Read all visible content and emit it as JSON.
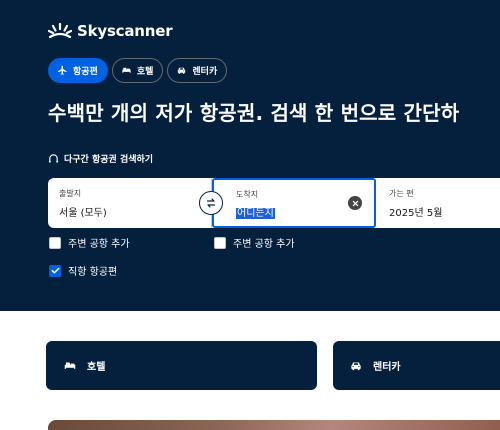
{
  "brand": {
    "name": "Skyscanner"
  },
  "tabs": [
    {
      "label": "항공편",
      "icon": "plane-icon",
      "active": true
    },
    {
      "label": "호텔",
      "icon": "bed-icon",
      "active": false
    },
    {
      "label": "렌터카",
      "icon": "car-icon",
      "active": false
    }
  ],
  "headline": "수백만 개의 저가 항공권. 검색 한 번으로 간단하",
  "multicity_label": "다구간 항공권 검색하기",
  "search": {
    "from": {
      "label": "출발지",
      "value": "서울 (모두)"
    },
    "to": {
      "label": "도착지",
      "value": "어디든지"
    },
    "depart": {
      "label": "가는 편",
      "value": "2025년 5월"
    }
  },
  "options": {
    "nearby_from": {
      "label": "주변 공항 추가",
      "checked": false
    },
    "nearby_to": {
      "label": "주변 공항 추가",
      "checked": false
    },
    "direct": {
      "label": "직항 항공편",
      "checked": true
    }
  },
  "cards": [
    {
      "label": "호텔",
      "icon": "bed-icon"
    },
    {
      "label": "렌터카",
      "icon": "car-icon"
    }
  ],
  "colors": {
    "hero_bg": "#05203c",
    "accent": "#0062e3",
    "selection": "#1f5fd8"
  }
}
